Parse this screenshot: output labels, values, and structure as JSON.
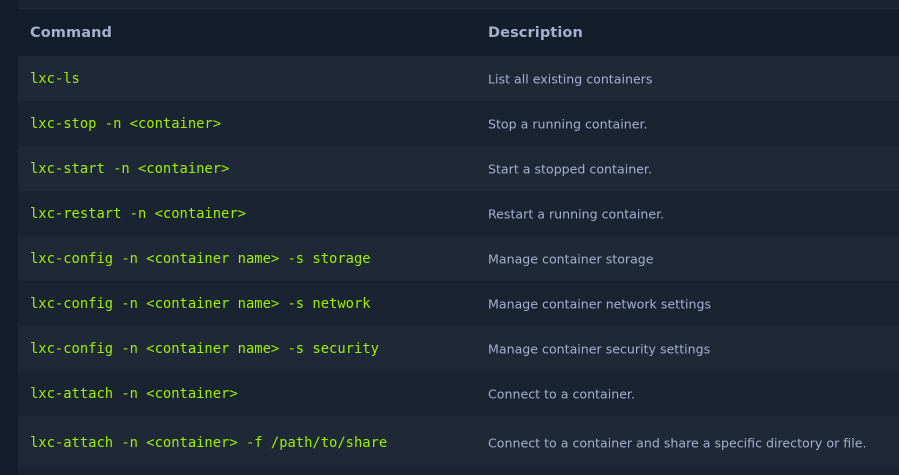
{
  "table": {
    "headers": {
      "command": "Command",
      "description": "Description"
    },
    "rows": [
      {
        "command": "lxc-ls",
        "description": "List all existing containers"
      },
      {
        "command": "lxc-stop -n <container>",
        "description": "Stop a running container."
      },
      {
        "command": "lxc-start -n <container>",
        "description": "Start a stopped container."
      },
      {
        "command": "lxc-restart -n <container>",
        "description": "Restart a running container."
      },
      {
        "command": "lxc-config -n <container name> -s storage",
        "description": "Manage container storage"
      },
      {
        "command": "lxc-config -n <container name> -s network",
        "description": "Manage container network settings"
      },
      {
        "command": "lxc-config -n <container name> -s security",
        "description": "Manage container security settings"
      },
      {
        "command": "lxc-attach -n <container>",
        "description": "Connect to a container."
      },
      {
        "command": "lxc-attach -n <container> -f /path/to/share",
        "description": "Connect to a container and share a specific directory or file."
      }
    ]
  },
  "colors": {
    "background": "#141d2b",
    "row_alt": "#1f2836",
    "command_text": "#9fef00",
    "description_text": "#a4b1cd"
  }
}
